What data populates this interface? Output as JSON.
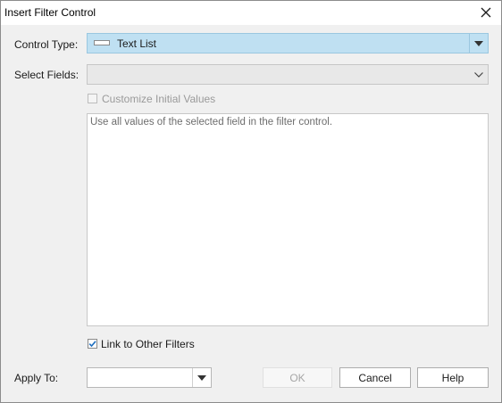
{
  "dialog": {
    "title": "Insert Filter Control"
  },
  "control_type": {
    "label": "Control Type:",
    "value": "Text List"
  },
  "select_fields": {
    "label": "Select Fields:",
    "value": ""
  },
  "customize_initial_values": {
    "label": "Customize Initial Values",
    "checked": false,
    "enabled": false
  },
  "description": {
    "text": "Use all values of the selected field in the filter control."
  },
  "link_to_other_filters": {
    "label": "Link to Other Filters",
    "checked": true
  },
  "apply_to": {
    "label": "Apply To:",
    "value": ""
  },
  "buttons": {
    "ok": "OK",
    "cancel": "Cancel",
    "help": "Help"
  },
  "colors": {
    "selected_combo_bg": "#bfe0f2",
    "check_mark": "#1f6fbf"
  }
}
